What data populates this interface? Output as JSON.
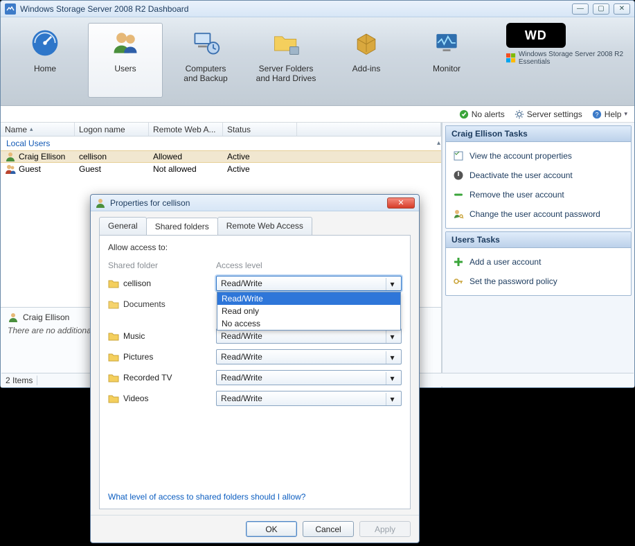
{
  "window": {
    "title": "Windows Storage Server 2008 R2 Dashboard"
  },
  "ribbon": {
    "items": [
      {
        "label": "Home"
      },
      {
        "label": "Users"
      },
      {
        "label": "Computers\nand Backup"
      },
      {
        "label": "Server Folders\nand Hard Drives"
      },
      {
        "label": "Add-ins"
      },
      {
        "label": "Monitor"
      }
    ],
    "brand_code": "WD",
    "brand_sub": "Windows Storage Server 2008 R2\nEssentials"
  },
  "status": {
    "alerts": "No alerts",
    "settings": "Server settings",
    "help": "Help"
  },
  "grid": {
    "columns": [
      "Name",
      "Logon name",
      "Remote Web A...",
      "Status"
    ],
    "group": "Local Users",
    "rows": [
      {
        "name": "Craig Ellison",
        "logon": "cellison",
        "rwa": "Allowed",
        "status": "Active"
      },
      {
        "name": "Guest",
        "logon": "Guest",
        "rwa": "Not allowed",
        "status": "Active"
      }
    ],
    "selected": 0
  },
  "detail": {
    "title": "Craig Ellison",
    "subtext": "There are no additional details for this item."
  },
  "footer": {
    "count": "2 Items"
  },
  "tasks": {
    "user_panel_title": "Craig Ellison Tasks",
    "user_items": [
      "View the account properties",
      "Deactivate the user account",
      "Remove the user account",
      "Change the user account password"
    ],
    "users_panel_title": "Users Tasks",
    "users_items": [
      "Add a user account",
      "Set the password policy"
    ]
  },
  "dialog": {
    "title": "Properties for cellison",
    "tabs": [
      "General",
      "Shared folders",
      "Remote Web Access"
    ],
    "active_tab": 1,
    "allow_label": "Allow access to:",
    "col_folder": "Shared folder",
    "col_access": "Access level",
    "folders": [
      {
        "name": "cellison",
        "access": "Read/Write",
        "open": true
      },
      {
        "name": "Documents",
        "access": "Read/Write"
      },
      {
        "name": "Music",
        "access": "Read/Write"
      },
      {
        "name": "Pictures",
        "access": "Read/Write"
      },
      {
        "name": "Recorded TV",
        "access": "Read/Write"
      },
      {
        "name": "Videos",
        "access": "Read/Write"
      }
    ],
    "access_options": [
      "Read/Write",
      "Read only",
      "No access"
    ],
    "help_link": "What level of access to shared folders should I allow?",
    "ok": "OK",
    "cancel": "Cancel",
    "apply": "Apply"
  }
}
